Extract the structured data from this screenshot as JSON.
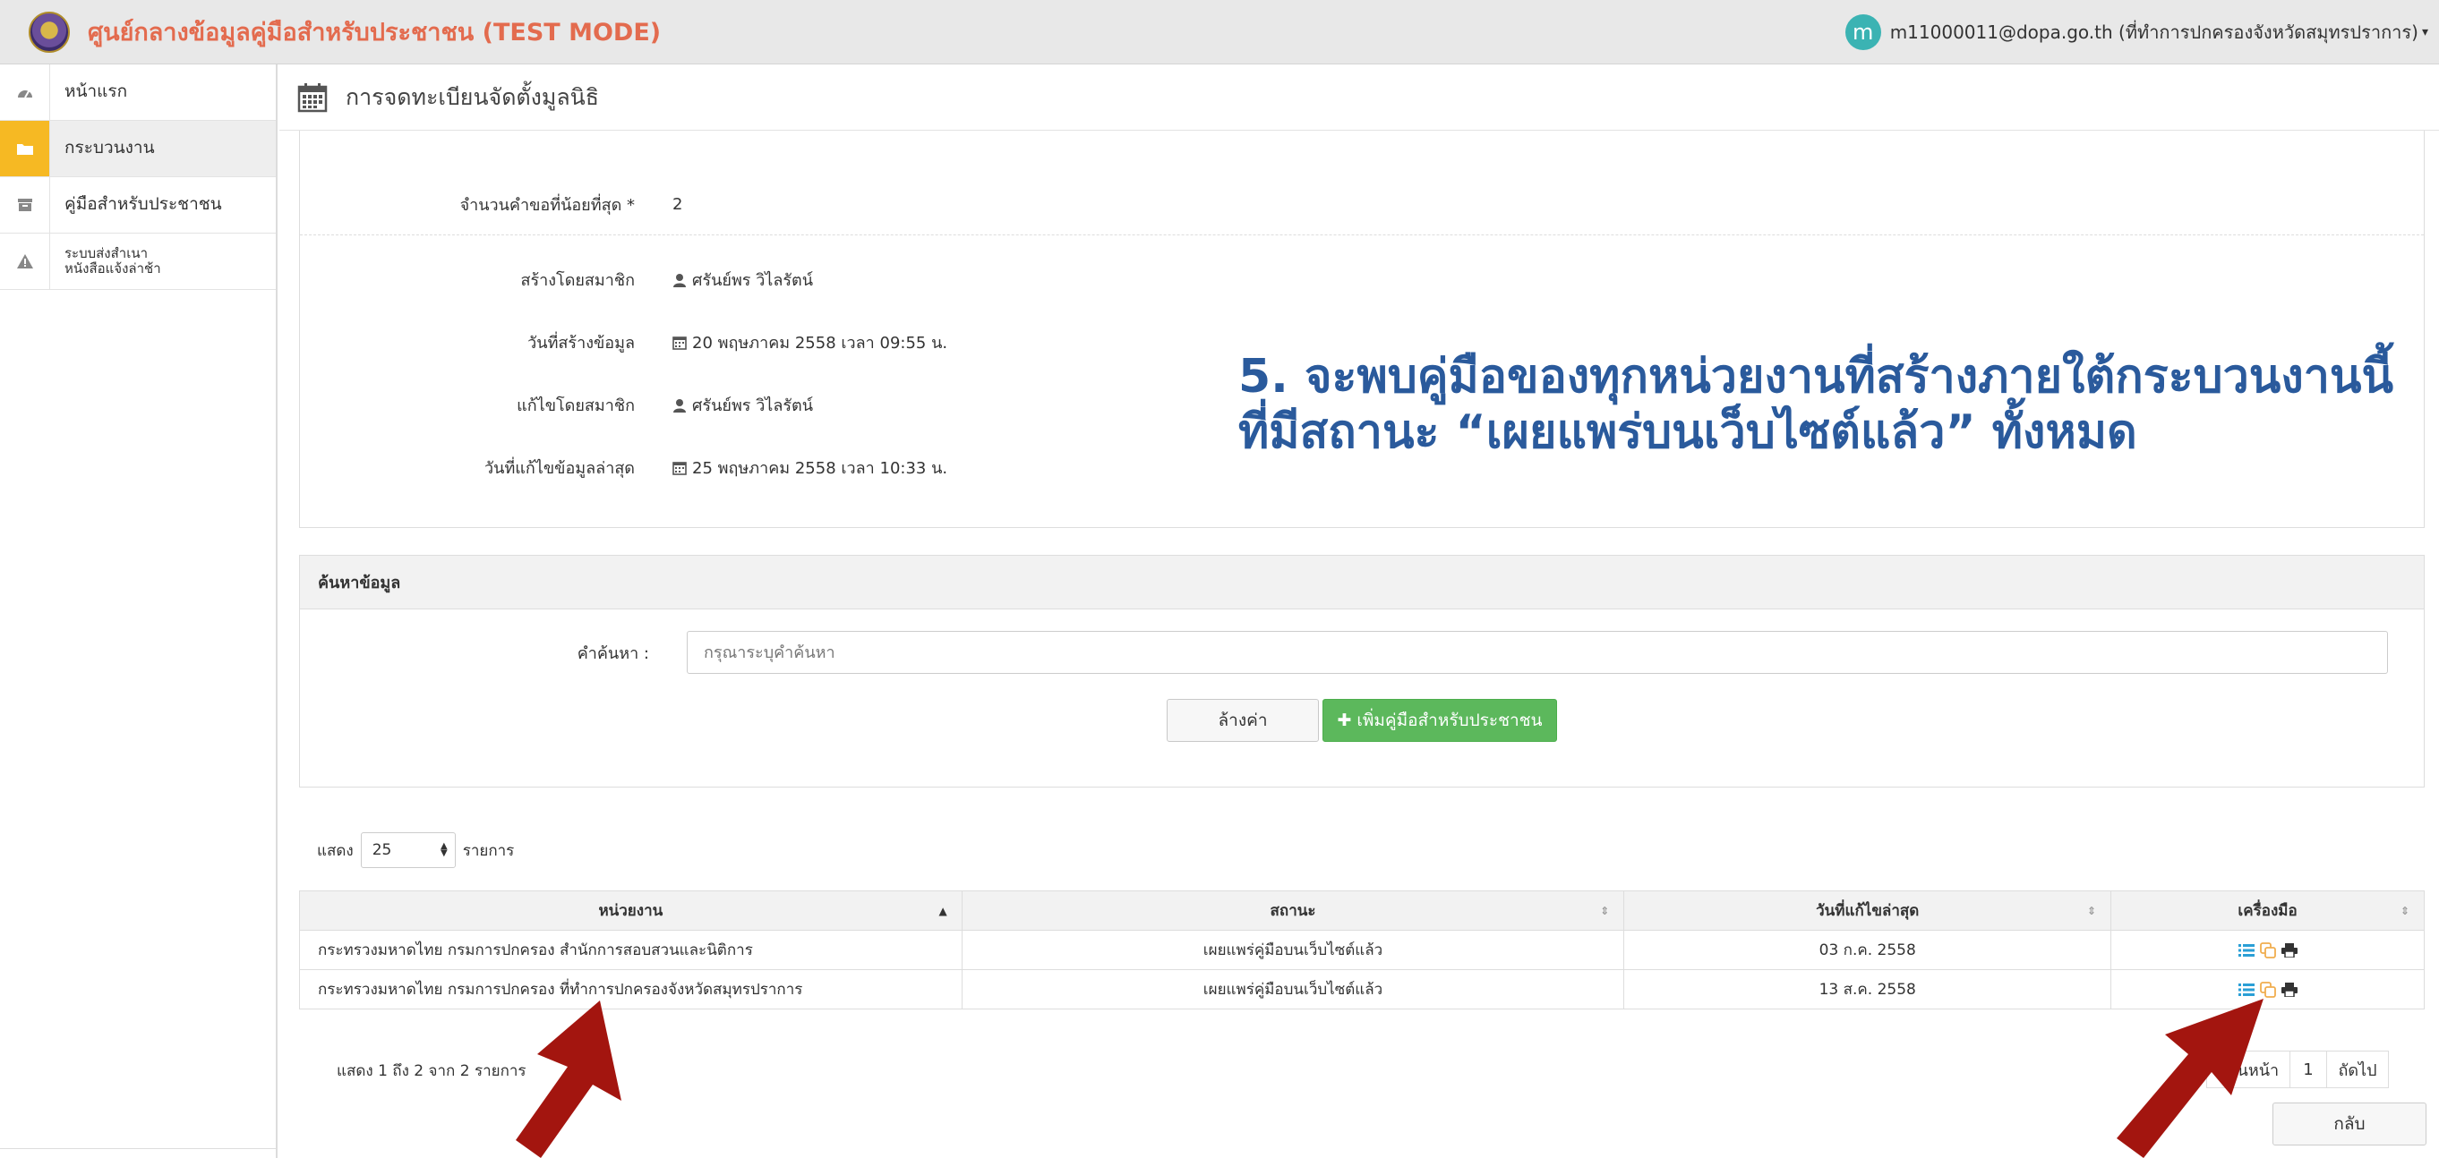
{
  "app": {
    "title": "ศูนย์กลางข้อมูลคู่มือสำหรับประชาชน (TEST MODE)",
    "user_initial": "m",
    "user_label": "m11000011@dopa.go.th (ที่ทำการปกครองจังหวัดสมุทรปราการ)"
  },
  "sidebar": {
    "items": [
      {
        "label": "หน้าแรก",
        "icon": "dashboard-icon"
      },
      {
        "label": "กระบวนงาน",
        "icon": "folder-icon",
        "active": true
      },
      {
        "label": "คู่มือสำหรับประชาชน",
        "icon": "archive-icon"
      },
      {
        "label_line1": "ระบบส่งสำเนา",
        "label_line2": "หนังสือแจ้งล่าช้า",
        "icon": "warning-icon"
      }
    ]
  },
  "page": {
    "title": "การจดทะเบียนจัดตั้งมูลนิธิ"
  },
  "details": {
    "min_requests_label": "จำนวนคำขอที่น้อยที่สุด *",
    "min_requests_value": "2",
    "created_by_label": "สร้างโดยสมาชิก",
    "created_by_value": "ศรันย์พร วิไลรัตน์",
    "created_date_label": "วันที่สร้างข้อมูล",
    "created_date_value": "20 พฤษภาคม 2558 เวลา 09:55 น.",
    "edited_by_label": "แก้ไขโดยสมาชิก",
    "edited_by_value": "ศรันย์พร วิไลรัตน์",
    "edited_date_label": "วันที่แก้ไขข้อมูลล่าสุด",
    "edited_date_value": "25 พฤษภาคม 2558 เวลา 10:33 น."
  },
  "callout": {
    "line1": "5. จะพบคู่มือของทุกหน่วยงานที่สร้างภายใต้กระบวนงานนี้",
    "line2": "ที่มีสถานะ “เผยแพร่บนเว็บไซต์แล้ว” ทั้งหมด",
    "color": "#2a5a9c"
  },
  "search": {
    "heading": "ค้นหาข้อมูล",
    "keyword_label": "คำค้นหา :",
    "placeholder": "กรุณาระบุคำค้นหา",
    "value": "",
    "clear_label": "ล้างค่า",
    "add_label": "เพิ่มคู่มือสำหรับประชาชน"
  },
  "table": {
    "show_label": "แสดง",
    "page_size": "25",
    "entries_label": "รายการ",
    "columns": [
      "หน่วยงาน",
      "สถานะ",
      "วันที่แก้ไขล่าสุด",
      "เครื่องมือ"
    ],
    "rows": [
      {
        "agency": "กระทรวงมหาดไทย กรมการปกครอง สำนักการสอบสวนและนิติการ",
        "status": "เผยแพร่คู่มือบนเว็บไซต์แล้ว",
        "date": "03 ก.ค. 2558"
      },
      {
        "agency": "กระทรวงมหาดไทย กรมการปกครอง ที่ทำการปกครองจังหวัดสมุทรปราการ",
        "status": "เผยแพร่คู่มือบนเว็บไซต์แล้ว",
        "date": "13 ส.ค. 2558"
      }
    ],
    "info": "แสดง 1 ถึง 2 จาก 2 รายการ",
    "pager": {
      "prev": "ก่อนหน้า",
      "current": "1",
      "next": "ถัดไป"
    },
    "back_label": "กลับ"
  },
  "colors": {
    "title_accent": "#e36b4e",
    "active_sidebar": "#f6b923",
    "add_button": "#5cb85c",
    "arrow": "#a3150f"
  }
}
